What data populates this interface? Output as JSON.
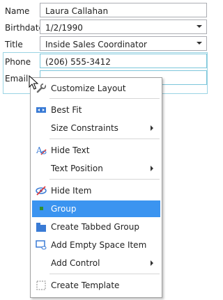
{
  "form": {
    "fields": [
      {
        "label": "Name",
        "value": "Laura Callahan"
      },
      {
        "label": "Birthdate",
        "value": "1/2/1990"
      },
      {
        "label": "Title",
        "value": "Inside Sales Coordinator"
      },
      {
        "label": "Phone",
        "value": "(206) 555-3412"
      },
      {
        "label": "Email",
        "value": ""
      }
    ]
  },
  "menu": {
    "items": [
      {
        "label": "Customize Layout",
        "icon": "wrench-icon"
      },
      {
        "label": "Best Fit",
        "icon": "best-fit-icon"
      },
      {
        "label": "Size Constraints",
        "icon": ""
      },
      {
        "label": "Hide Text",
        "icon": "hide-text-icon"
      },
      {
        "label": "Text Position",
        "icon": ""
      },
      {
        "label": "Hide Item",
        "icon": "hide-item-icon"
      },
      {
        "label": "Group",
        "icon": "group-icon"
      },
      {
        "label": "Create Tabbed Group",
        "icon": "tabbed-group-icon"
      },
      {
        "label": "Add Empty Space Item",
        "icon": "empty-space-icon"
      },
      {
        "label": "Add Control",
        "icon": ""
      },
      {
        "label": "Create Template",
        "icon": "template-icon"
      }
    ]
  },
  "colors": {
    "selection": "#3b94f0",
    "focus_border": "#7cc6da"
  }
}
